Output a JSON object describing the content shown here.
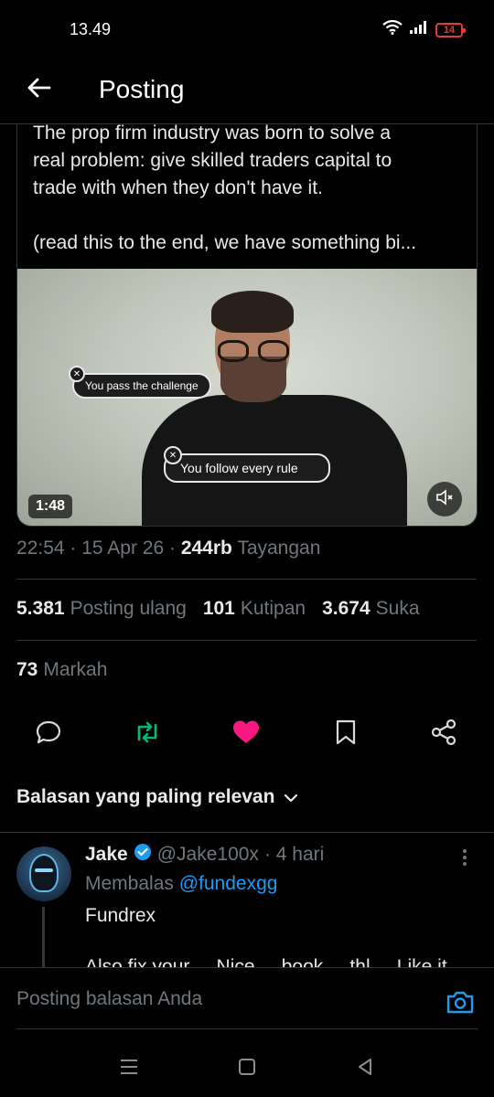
{
  "status_bar": {
    "time": "13.49",
    "battery": "14",
    "icons": [
      "wifi-icon",
      "signal-icon",
      "battery-icon"
    ]
  },
  "header": {
    "title": "Posting",
    "back_icon": "arrow-left-icon"
  },
  "post": {
    "text_lines": [
      "The prop firm industry was born to solve a",
      "real problem: give skilled traders capital to",
      "trade with when they don't have it.",
      "(read this to the end, we have something bi..."
    ],
    "video": {
      "duration": "1:48",
      "captions": [
        "You pass the challenge",
        "You follow every rule"
      ],
      "mute_icon": "volume-muted-icon"
    },
    "meta": {
      "time": "22:54",
      "date": "15 Apr 26",
      "views_value": "244rb",
      "views_label": "Tayangan"
    },
    "stats": {
      "reposts_value": "5.381",
      "reposts_label": "Posting ulang",
      "quotes_value": "101",
      "quotes_label": "Kutipan",
      "likes_value": "3.674",
      "likes_label": "Suka",
      "bookmarks_value": "73",
      "bookmarks_label": "Markah"
    },
    "actions": [
      "reply-icon",
      "repost-icon",
      "like-icon",
      "bookmark-icon",
      "share-icon"
    ],
    "colors": {
      "repost": "#00ba7c",
      "like": "#f91880",
      "link": "#1d9bf0"
    }
  },
  "replies": {
    "sort_label": "Balasan yang paling relevan",
    "items": [
      {
        "name": "Jake",
        "verified": true,
        "handle": "@Jake100x",
        "age": "· 4 hari",
        "replying_prefix": "Membalas",
        "replying_to": "@fundexgg",
        "text": "Fundrex",
        "text_cut": "Also fix your ... Nice ... book ... thl ... Like it"
      }
    ]
  },
  "reply_bar": {
    "placeholder": "Posting balasan Anda",
    "camera_icon": "camera-icon"
  },
  "nav_bar": [
    "menu-icon",
    "home-icon",
    "back-icon"
  ]
}
